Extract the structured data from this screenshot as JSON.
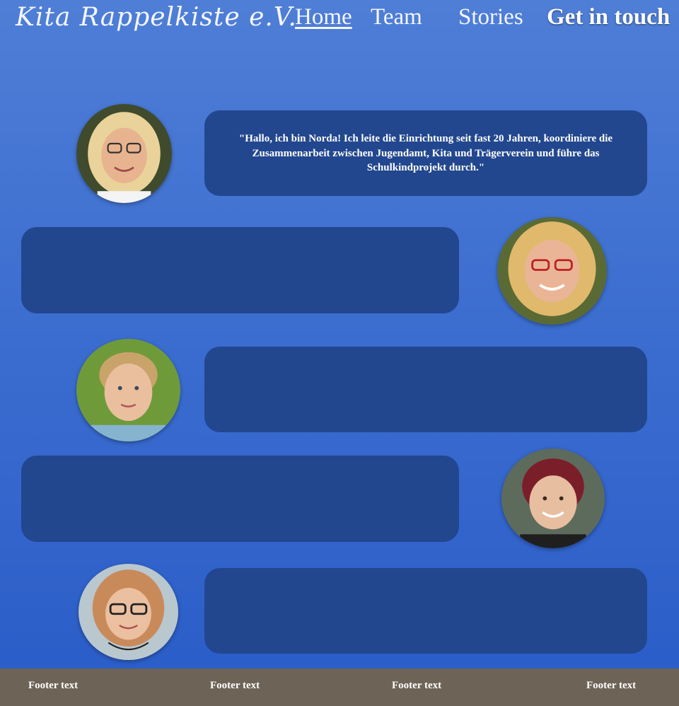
{
  "nav": {
    "brand": "Kita Rappelkiste e.V.",
    "links": [
      {
        "label": "Home",
        "active": true
      },
      {
        "label": "Team",
        "active": false
      },
      {
        "label": "Stories",
        "active": false
      },
      {
        "label": "Get in touch",
        "active": false
      }
    ]
  },
  "team": [
    {
      "quote": "\"Hallo, ich bin Norda! Ich leite die Einrichtung seit fast 20 Jahren, koordiniere die Zusammenarbeit zwischen Jugendamt, Kita und Trägerverein und führe das Schulkindprojekt durch.\""
    },
    {
      "quote": ""
    },
    {
      "quote": ""
    },
    {
      "quote": ""
    },
    {
      "quote": ""
    }
  ],
  "footer": {
    "items": [
      "Footer text",
      "Footer text",
      "Footer text",
      "Footer text"
    ]
  },
  "colors": {
    "background_top": "#4f7ed6",
    "background_bottom": "#2a5cc8",
    "bubble": "#22478f",
    "footer": "#6e6357"
  }
}
